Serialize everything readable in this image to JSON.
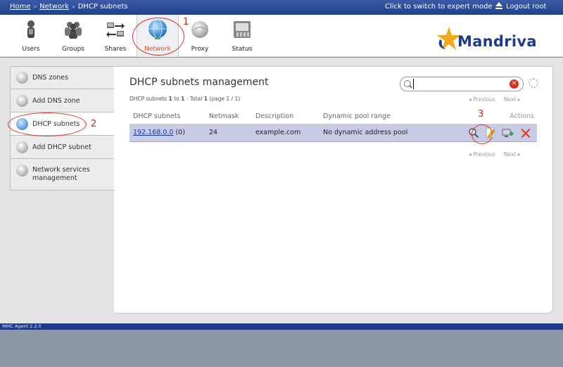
{
  "breadcrumb": {
    "items": [
      "Home",
      "Network",
      "DHCP subnets"
    ]
  },
  "topbar": {
    "expert_label": "Click to switch to expert mode",
    "logout_label": "Logout root"
  },
  "toolbar": {
    "items": [
      {
        "label": "Users",
        "icon": "users-icon"
      },
      {
        "label": "Groups",
        "icon": "groups-icon"
      },
      {
        "label": "Shares",
        "icon": "shares-icon"
      },
      {
        "label": "Network",
        "icon": "network-globe-icon",
        "active": true
      },
      {
        "label": "Proxy",
        "icon": "proxy-icon"
      },
      {
        "label": "Status",
        "icon": "status-icon"
      }
    ]
  },
  "logo": {
    "text": "Mandriva"
  },
  "sidebar": {
    "items": [
      {
        "label": "DNS zones"
      },
      {
        "label": "Add DNS zone"
      },
      {
        "label": "DHCP subnets",
        "active": true
      },
      {
        "label": "Add DHCP subnet"
      },
      {
        "label": "Network services management"
      }
    ]
  },
  "page": {
    "title": "DHCP subnets management",
    "count_prefix": "DHCP subnets",
    "count_from": "1",
    "count_to_word": "to",
    "count_to": "1",
    "count_total_label": "- Total",
    "count_total": "1",
    "count_page": "(page 1 / 1)"
  },
  "search": {
    "value": "",
    "placeholder": ""
  },
  "pager": {
    "previous": "Previous",
    "next": "Next"
  },
  "table": {
    "headers": [
      "DHCP subnets",
      "Netmask",
      "Description",
      "Dynamic pool range",
      "Actions"
    ],
    "rows": [
      {
        "subnet": "192.168.0.0",
        "count": "(0)",
        "netmask": "24",
        "description": "example.com",
        "pool": "No dynamic address pool"
      }
    ]
  },
  "annotations": [
    "1",
    "2",
    "3"
  ],
  "footer": {
    "version": "MMC Agent 2.2.0"
  },
  "colors": {
    "accent": "#e8501e",
    "topbar": "#22408a",
    "row": "#c8cbe6",
    "annotation": "#d8201a"
  }
}
